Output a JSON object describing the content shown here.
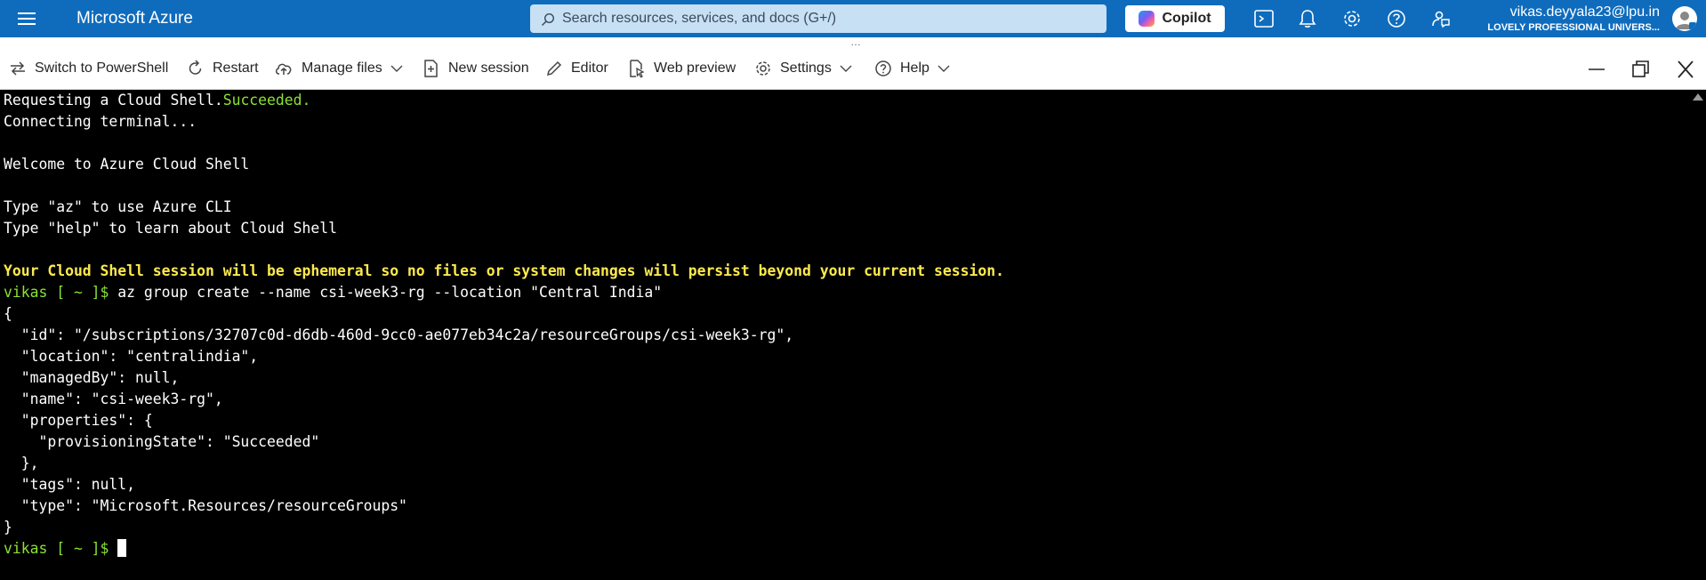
{
  "header": {
    "brand": "Microsoft Azure",
    "search_placeholder": "Search resources, services, and docs (G+/)",
    "copilot_label": "Copilot",
    "account_email": "vikas.deyyala23@lpu.in",
    "account_org": "LOVELY PROFESSIONAL UNIVERS...",
    "icons": [
      "hamburger-icon",
      "search-icon",
      "cloud-shell-icon",
      "bell-icon",
      "gear-icon",
      "help-icon",
      "feedback-icon"
    ]
  },
  "toolbar": {
    "switch_label": "Switch to PowerShell",
    "restart_label": "Restart",
    "manage_files_label": "Manage files",
    "new_session_label": "New session",
    "editor_label": "Editor",
    "web_preview_label": "Web preview",
    "settings_label": "Settings",
    "help_label": "Help",
    "grip": "…"
  },
  "terminal": {
    "l1_a": "Requesting a Cloud Shell.",
    "l1_b": "Succeeded.",
    "l2": "Connecting terminal...",
    "l3": "Welcome to Azure Cloud Shell",
    "l4": "Type \"az\" to use Azure CLI",
    "l5": "Type \"help\" to learn about Cloud Shell",
    "l6": "Your Cloud Shell session will be ephemeral so no files or system changes will persist beyond your current session.",
    "prompt": "vikas [ ~ ]$",
    "command": " az group create --name csi-week3-rg --location \"Central India\"",
    "json_lines": [
      "{",
      "  \"id\": \"/subscriptions/32707c0d-d6db-460d-9cc0-ae077eb34c2a/resourceGroups/csi-week3-rg\",",
      "  \"location\": \"centralindia\",",
      "  \"managedBy\": null,",
      "  \"name\": \"csi-week3-rg\",",
      "  \"properties\": {",
      "    \"provisioningState\": \"Succeeded\"",
      "  },",
      "  \"tags\": null,",
      "  \"type\": \"Microsoft.Resources/resourceGroups\"",
      "}"
    ],
    "prompt2": "vikas [ ~ ]$"
  },
  "colors": {
    "azure_blue": "#0f6cbd",
    "terminal_green": "#8ae234",
    "terminal_yellow": "#fce94f"
  }
}
